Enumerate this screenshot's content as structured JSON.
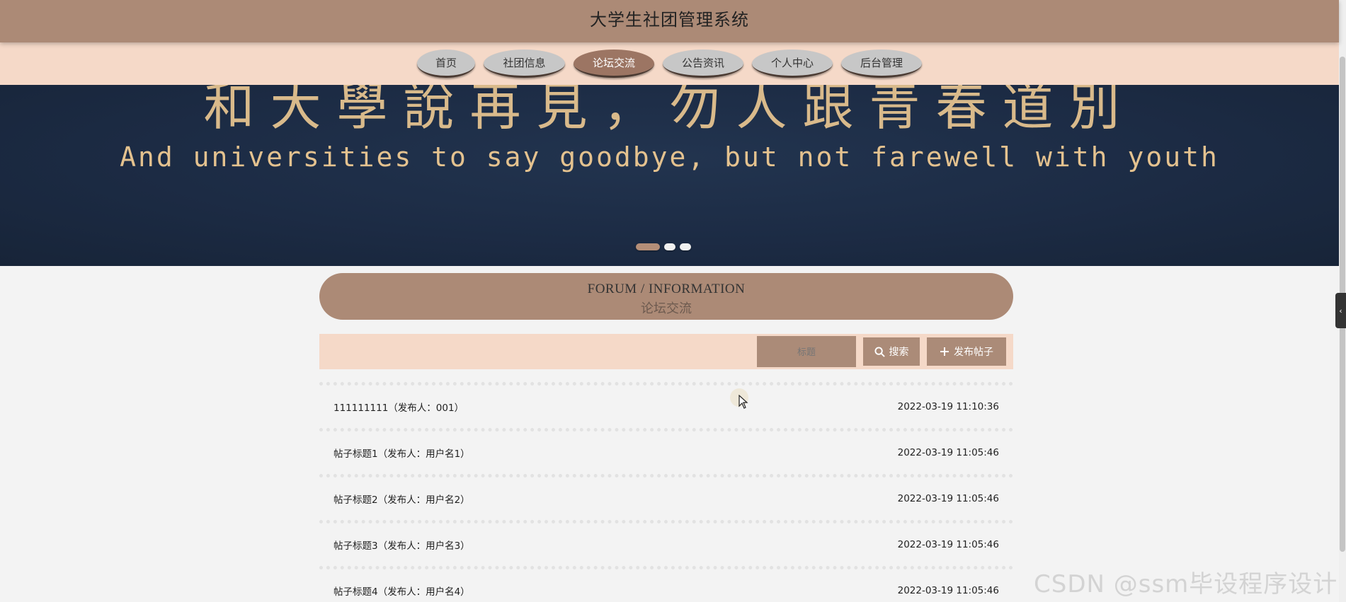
{
  "header": {
    "site_title": "大学生社团管理系统"
  },
  "nav": {
    "items": [
      {
        "label": "首页"
      },
      {
        "label": "社团信息"
      },
      {
        "label": "论坛交流"
      },
      {
        "label": "公告资讯"
      },
      {
        "label": "个人中心"
      },
      {
        "label": "后台管理"
      }
    ],
    "active_index": 2
  },
  "banner": {
    "text_cn": "和大學說再見，勿人跟青春道別",
    "text_en": "And universities to say goodbye, but not farewell with youth",
    "slide_count": 3,
    "active_slide": 0
  },
  "section": {
    "title_en": "FORUM / INFORMATION",
    "title_cn": "论坛交流"
  },
  "toolbar": {
    "search_placeholder": "标题",
    "search_label": "搜索",
    "publish_label": "发布帖子"
  },
  "posts": [
    {
      "title": "111111111（发布人：001）",
      "time": "2022-03-19 11:10:36"
    },
    {
      "title": "帖子标题1（发布人：用户名1）",
      "time": "2022-03-19 11:05:46"
    },
    {
      "title": "帖子标题2（发布人：用户名2）",
      "time": "2022-03-19 11:05:46"
    },
    {
      "title": "帖子标题3（发布人：用户名3）",
      "time": "2022-03-19 11:05:46"
    },
    {
      "title": "帖子标题4（发布人：用户名4）",
      "time": "2022-03-19 11:05:46"
    }
  ],
  "watermark": "CSDN @ssm毕设程序设计",
  "colors": {
    "header_bg": "#ac8a76",
    "nav_bg": "#f5d9c8",
    "nav_active": "#9c7563",
    "banner_bg": "#1c2b44",
    "banner_text": "#e4c28f"
  }
}
